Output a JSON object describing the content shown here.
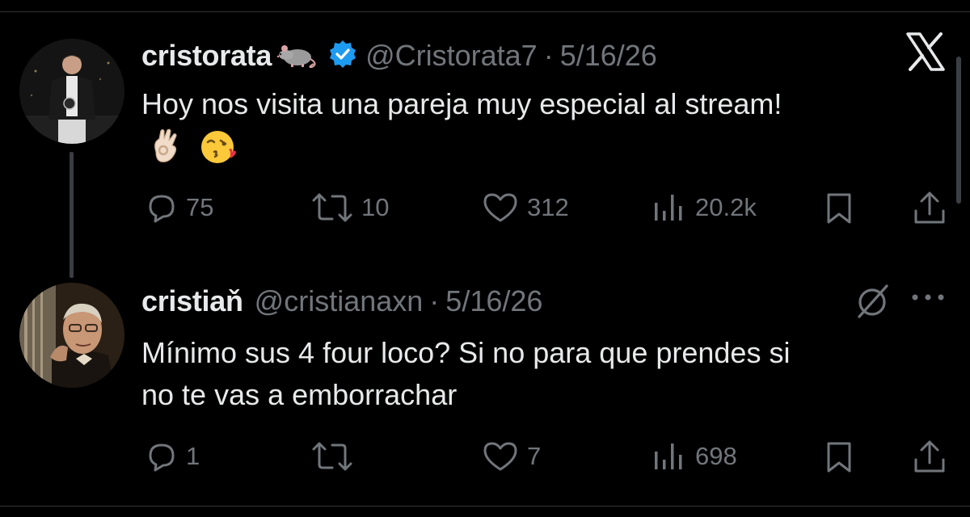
{
  "colors": {
    "background": "#000000",
    "primary_text": "#e7e9ea",
    "secondary_text": "#71767b",
    "verified_blue": "#1d9bf0",
    "divider": "#2f3336"
  },
  "brand": {
    "icon": "x-logo-icon"
  },
  "tweets": [
    {
      "display_name": "cristorata",
      "name_emoji": "rat-emoji",
      "verified": true,
      "handle": "@Cristorata7",
      "separator": "·",
      "date": "5/16/26",
      "text_line1": "Hoy nos visita una pareja muy especial al stream!",
      "emojis": [
        "ok-hand-emoji",
        "kissing-heart-emoji"
      ],
      "actions": {
        "replies": "75",
        "reposts": "10",
        "likes": "312",
        "views": "20.2k"
      }
    },
    {
      "display_name": "cristiaň",
      "handle": "@cristianaxn",
      "separator": "·",
      "date": "5/16/26",
      "text_line1": "Mínimo sus 4 four loco? Si no para que prendes si",
      "text_line2": "no te vas a emborrachar",
      "header_icons": [
        "grok-icon",
        "more-icon"
      ],
      "actions": {
        "replies": "1",
        "reposts": "",
        "likes": "7",
        "views": "698"
      }
    }
  ]
}
